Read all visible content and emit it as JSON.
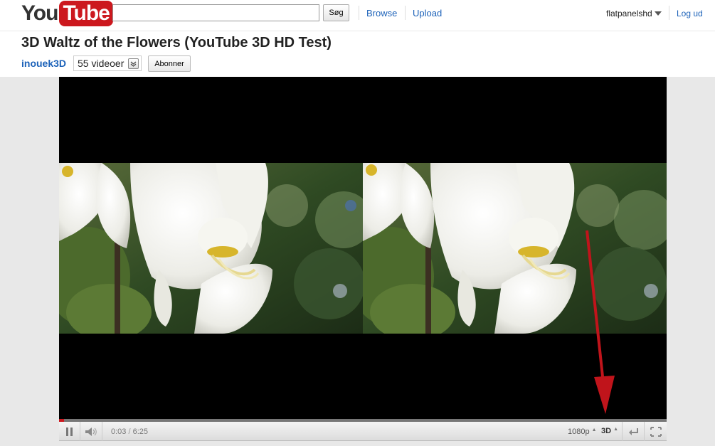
{
  "header": {
    "logo_you": "You",
    "logo_tube": "Tube",
    "search_value": "",
    "search_button": "Søg",
    "nav_browse": "Browse",
    "nav_upload": "Upload",
    "username": "flatpanelshd",
    "logout": "Log ud"
  },
  "video": {
    "title": "3D Waltz of the Flowers (YouTube 3D HD Test)",
    "channel": "inouek3D",
    "video_count": "55 videoer",
    "subscribe": "Abonner"
  },
  "player": {
    "current_time": "0:03",
    "separator": "/",
    "duration": "6:25",
    "progress_fraction": 0.008,
    "quality": "1080p",
    "mode_3d": "3D",
    "annotation_arrow_color": "#c0141b",
    "accent_color": "#cc181e",
    "icons": [
      "pause-icon",
      "volume-icon",
      "3d-menu-caret",
      "pop-out-icon",
      "fullscreen-icon"
    ]
  }
}
